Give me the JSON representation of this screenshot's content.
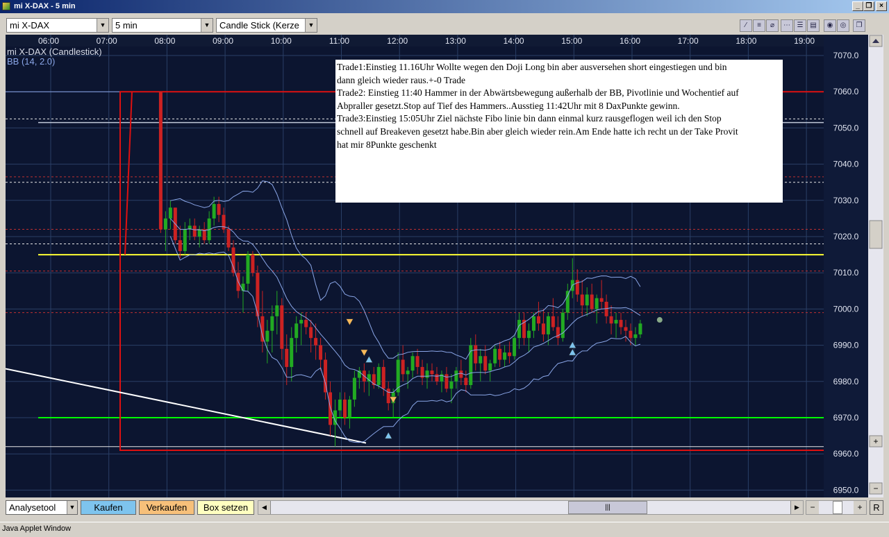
{
  "window": {
    "title": "mi X-DAX - 5 min"
  },
  "toolbar": {
    "symbol": "mi X-DAX",
    "interval": "5 min",
    "chart_type": "Candle Stick (Kerze"
  },
  "chart_labels": {
    "series": "mi X-DAX (Candlestick)",
    "indicator": "BB (14, 2.0)"
  },
  "note": {
    "lines": [
      "Trade1:Einstieg 11.16Uhr Wollte wegen den Doji Long bin aber ausversehen short eingestiegen und bin",
      "dann gleich wieder raus.+-0 Trade",
      "Trade2: Einstieg 11:40 Hammer in der Abwärtsbewegung außerhalb der BB, Pivotlinie und Wochentief auf",
      "Abpraller gesetzt.Stop auf  Tief des Hammers..Ausstieg   11:42Uhr mit 8 DaxPunkte gewinn.",
      "Trade3:Einstieg 15:05Uhr Ziel nächste Fibo linie bin dann einmal kurz rausgeflogen weil ich den Stop",
      "schnell auf Breakeven gesetzt habe.Bin aber gleich wieder rein.Am Ende hatte ich recht un der Take Provit",
      "hat mir 8Punkte geschenkt"
    ]
  },
  "bottom": {
    "analysis": "Analysetool",
    "buy": "Kaufen",
    "sell": "Verkaufen",
    "box": "Box setzen",
    "scroll_grip": "|||",
    "reset": "R"
  },
  "status": "Java Applet Window",
  "colors": {
    "chart_bg": "#0c1530",
    "grid": "#2a3f66",
    "bull": "#22aa22",
    "bear": "#cc2222",
    "bb": "#8aa6e8",
    "support_green": "#00ff00",
    "pivot_yellow": "#ffff33",
    "range_red": "#dd1111",
    "buy_btn": "#7ec4ee",
    "sell_btn": "#f7c07a",
    "box_btn": "#ffffc0"
  },
  "chart_data": {
    "type": "candlestick",
    "time_ticks": [
      "06:00",
      "07:00",
      "08:00",
      "09:00",
      "10:00",
      "11:00",
      "12:00",
      "13:00",
      "14:00",
      "15:00",
      "16:00",
      "17:00",
      "18:00",
      "19:00"
    ],
    "price_ticks": [
      "7070.0",
      "7060.0",
      "7050.0",
      "7040.0",
      "7030.0",
      "7020.0",
      "7010.0",
      "7000.0",
      "6990.0",
      "6980.0",
      "6970.0",
      "6960.0",
      "6950.0"
    ],
    "ylim": [
      6948,
      7074
    ],
    "start_time": "08:00",
    "interval_minutes": 5,
    "ohlc": [
      [
        7060,
        7060,
        7021,
        7022
      ],
      [
        7022,
        7027,
        7016,
        7025
      ],
      [
        7025,
        7030,
        7022,
        7028
      ],
      [
        7028,
        7028,
        7018,
        7019
      ],
      [
        7019,
        7023,
        7014,
        7016
      ],
      [
        7016,
        7024,
        7015,
        7022
      ],
      [
        7022,
        7025,
        7019,
        7023
      ],
      [
        7023,
        7025,
        7019,
        7020
      ],
      [
        7020,
        7023,
        7017,
        7022
      ],
      [
        7022,
        7024,
        7018,
        7019
      ],
      [
        7019,
        7027,
        7018,
        7025
      ],
      [
        7025,
        7031,
        7023,
        7029
      ],
      [
        7029,
        7031,
        7024,
        7026
      ],
      [
        7026,
        7028,
        7021,
        7022
      ],
      [
        7022,
        7023,
        7016,
        7017
      ],
      [
        7017,
        7019,
        7009,
        7010
      ],
      [
        7010,
        7013,
        7003,
        7005
      ],
      [
        7005,
        7009,
        6999,
        7007
      ],
      [
        7007,
        7016,
        7005,
        7015
      ],
      [
        7015,
        7016,
        7009,
        7010
      ],
      [
        7010,
        7012,
        6995,
        6998
      ],
      [
        6998,
        7005,
        6988,
        6991
      ],
      [
        6991,
        6997,
        6985,
        6994
      ],
      [
        6994,
        7001,
        6988,
        6998
      ],
      [
        6998,
        7005,
        6993,
        7001
      ],
      [
        7001,
        7003,
        6986,
        6989
      ],
      [
        6989,
        6993,
        6979,
        6984
      ],
      [
        6984,
        6995,
        6980,
        6992
      ],
      [
        6992,
        6998,
        6988,
        6996
      ],
      [
        6996,
        6999,
        6990,
        6997
      ],
      [
        6997,
        6999,
        6993,
        6995
      ],
      [
        6995,
        6997,
        6988,
        6992
      ],
      [
        6992,
        6996,
        6986,
        6990
      ],
      [
        6990,
        6992,
        6983,
        6986
      ],
      [
        6986,
        6988,
        6975,
        6977
      ],
      [
        6977,
        6980,
        6965,
        6968
      ],
      [
        6968,
        6975,
        6962,
        6972
      ],
      [
        6972,
        6977,
        6970,
        6975
      ],
      [
        6975,
        6977,
        6968,
        6970
      ],
      [
        6970,
        6976,
        6967,
        6975
      ],
      [
        6975,
        6983,
        6973,
        6981
      ],
      [
        6981,
        6984,
        6978,
        6983
      ],
      [
        6983,
        6985,
        6977,
        6980
      ],
      [
        6980,
        6983,
        6976,
        6982
      ],
      [
        6982,
        6984,
        6978,
        6979
      ],
      [
        6979,
        6985,
        6978,
        6984
      ],
      [
        6984,
        6986,
        6976,
        6978
      ],
      [
        6978,
        6980,
        6972,
        6974
      ],
      [
        6974,
        6978,
        6970,
        6977
      ],
      [
        6977,
        6988,
        6976,
        6986
      ],
      [
        6986,
        6990,
        6980,
        6982
      ],
      [
        6982,
        6984,
        6978,
        6983
      ],
      [
        6983,
        6988,
        6981,
        6987
      ],
      [
        6987,
        6989,
        6982,
        6984
      ],
      [
        6984,
        6986,
        6979,
        6981
      ],
      [
        6981,
        6985,
        6978,
        6983
      ],
      [
        6983,
        6985,
        6980,
        6982
      ],
      [
        6982,
        6984,
        6979,
        6980
      ],
      [
        6980,
        6983,
        6977,
        6982
      ],
      [
        6982,
        6984,
        6977,
        6978
      ],
      [
        6978,
        6982,
        6974,
        6980
      ],
      [
        6980,
        6984,
        6978,
        6983
      ],
      [
        6983,
        6986,
        6979,
        6981
      ],
      [
        6981,
        6983,
        6977,
        6979
      ],
      [
        6979,
        6992,
        6978,
        6990
      ],
      [
        6990,
        6993,
        6983,
        6985
      ],
      [
        6985,
        6989,
        6980,
        6987
      ],
      [
        6987,
        6990,
        6982,
        6983
      ],
      [
        6983,
        6986,
        6980,
        6985
      ],
      [
        6985,
        6990,
        6984,
        6989
      ],
      [
        6989,
        6991,
        6984,
        6986
      ],
      [
        6986,
        6990,
        6984,
        6988
      ],
      [
        6988,
        6991,
        6985,
        6987
      ],
      [
        6987,
        6993,
        6986,
        6992
      ],
      [
        6992,
        6999,
        6989,
        6997
      ],
      [
        6997,
        6999,
        6990,
        6992
      ],
      [
        6992,
        6996,
        6988,
        6994
      ],
      [
        6994,
        6999,
        6992,
        6998
      ],
      [
        6998,
        7002,
        6994,
        6996
      ],
      [
        6996,
        7000,
        6991,
        6993
      ],
      [
        6993,
        6999,
        6990,
        6998
      ],
      [
        6998,
        7003,
        6994,
        6995
      ],
      [
        6995,
        6998,
        6990,
        6992
      ],
      [
        6992,
        7000,
        6991,
        6999
      ],
      [
        6999,
        7007,
        6997,
        7005
      ],
      [
        7005,
        7014,
        7003,
        7008
      ],
      [
        7008,
        7011,
        7002,
        7004
      ],
      [
        7004,
        7008,
        6998,
        7001
      ],
      [
        7001,
        7006,
        6998,
        7004
      ],
      [
        7004,
        7007,
        6999,
        7000
      ],
      [
        7000,
        7004,
        6996,
        7003
      ],
      [
        7003,
        7008,
        7000,
        7002
      ],
      [
        7002,
        7004,
        6996,
        6998
      ],
      [
        6998,
        7001,
        6993,
        6996
      ],
      [
        6996,
        6999,
        6992,
        6997
      ],
      [
        6997,
        6999,
        6993,
        6995
      ],
      [
        6995,
        6997,
        6991,
        6994
      ],
      [
        6994,
        6996,
        6990,
        6992
      ],
      [
        6992,
        6995,
        6990,
        6993
      ],
      [
        6993,
        6997,
        6992,
        6996
      ]
    ]
  }
}
